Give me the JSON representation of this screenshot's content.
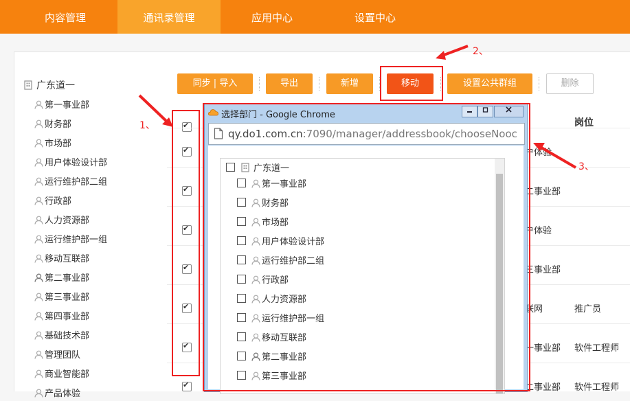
{
  "nav": {
    "items": [
      {
        "label": "内容管理"
      },
      {
        "label": "通讯录管理",
        "active": true
      },
      {
        "label": "应用中心"
      },
      {
        "label": "设置中心"
      }
    ]
  },
  "sidebar": {
    "root": "广东道一",
    "items": [
      "第一事业部",
      "财务部",
      "市场部",
      "用户体验设计部",
      "运行维护部二组",
      "行政部",
      "人力资源部",
      "运行维护部一组",
      "移动互联部",
      "第二事业部",
      "第三事业部",
      "第四事业部",
      "基础技术部",
      "管理团队",
      "商业智能部",
      "产品体验"
    ]
  },
  "toolbar": {
    "sync_import": "同步 | 导入",
    "export": "导出",
    "add": "新增",
    "move": "移动",
    "set_public_group": "设置公共群组",
    "delete": "删除"
  },
  "table": {
    "header_position": "岗位",
    "rows": [
      {
        "dept": "",
        "position": ""
      },
      {
        "dept": "户体验",
        "position": ""
      },
      {
        "dept": "二事业部",
        "position": ""
      },
      {
        "dept": "户体验",
        "position": ""
      },
      {
        "dept": "三事业部",
        "position": ""
      },
      {
        "dept": "联网",
        "position": "推广员"
      },
      {
        "dept": "一事业部",
        "position": "软件工程师"
      },
      {
        "dept": "二事业部",
        "position": "软件工程师"
      }
    ]
  },
  "annotations": [
    "1、",
    "2、",
    "3、"
  ],
  "popup": {
    "title": "选择部门 - Google Chrome",
    "url_host": "qy.do1.com.cn",
    "url_path": ":7090/manager/addressbook/chooseNooc",
    "tree_root": "广东道一",
    "tree_items": [
      "第一事业部",
      "财务部",
      "市场部",
      "用户体验设计部",
      "运行维护部二组",
      "行政部",
      "人力资源部",
      "运行维护部一组",
      "移动互联部",
      "第二事业部",
      "第三事业部"
    ]
  },
  "colors": {
    "nav_bg": "#f6820e",
    "nav_active": "#f9a42b",
    "button": "#f79a26",
    "move_button": "#f25417",
    "annotation_red": "#e22"
  }
}
